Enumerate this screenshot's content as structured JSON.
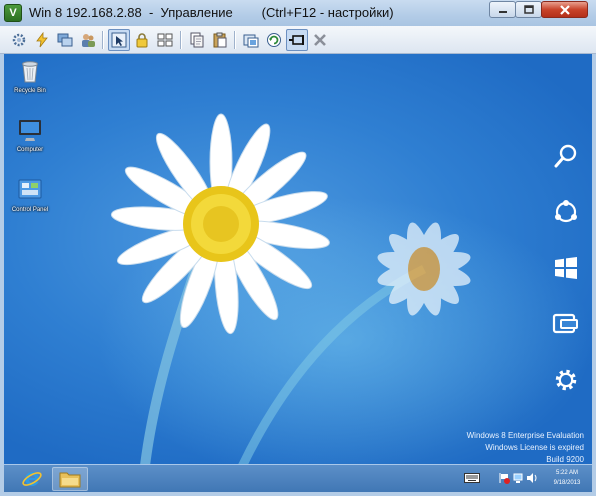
{
  "window": {
    "title": "Win 8 192.168.2.88  -  Управление        (Ctrl+F12 - настройки)",
    "app_icon_letter": "V"
  },
  "toolbar": {
    "buttons": [
      {
        "icon": "settings-gear-icon"
      },
      {
        "icon": "power-bolt-icon"
      },
      {
        "icon": "windows-stack-icon"
      },
      {
        "icon": "users-icon"
      },
      {
        "icon": "pointer-control-icon"
      },
      {
        "icon": "lock-icon"
      },
      {
        "icon": "keys-icon"
      },
      {
        "icon": "copy-icon"
      },
      {
        "icon": "paste-icon"
      },
      {
        "icon": "screenshot-icon"
      },
      {
        "icon": "refresh-icon"
      },
      {
        "icon": "pin-icon"
      },
      {
        "icon": "close-x-icon"
      }
    ]
  },
  "desktop": {
    "icons": [
      {
        "label": "Recycle Bin"
      },
      {
        "label": "Computer"
      },
      {
        "label": "Control Panel"
      }
    ],
    "charms": [
      "search-icon",
      "share-icon",
      "start-icon",
      "devices-icon",
      "settings-icon"
    ],
    "watermark": {
      "line1": "Windows 8 Enterprise Evaluation",
      "line2": "Windows License is expired",
      "line3": "Build 9200"
    }
  },
  "taskbar": {
    "apps": [
      "internet-explorer-icon",
      "file-explorer-icon"
    ],
    "clock": {
      "time": "5:22 AM",
      "date": "9/18/2013"
    }
  },
  "colors": {
    "desktop_blue": "#2f7fd2",
    "titlebar": "#b3cce7",
    "close_red": "#c9442b"
  }
}
